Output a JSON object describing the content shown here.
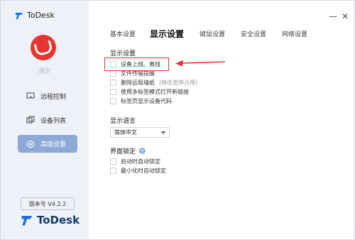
{
  "app": {
    "title": "ToDesk",
    "brand_bottom": "ToDesk"
  },
  "window_controls": {
    "minimize": "—",
    "close": "✕"
  },
  "user": {
    "name": "满岁"
  },
  "sidebar": {
    "items": [
      {
        "label": "远程控制",
        "icon": "remote-control-icon"
      },
      {
        "label": "设备列表",
        "icon": "device-list-icon"
      },
      {
        "label": "高级设置",
        "icon": "settings-icon",
        "active": true
      }
    ],
    "version": "版本号 V4.2.2"
  },
  "tabs": [
    {
      "label": "基本设置"
    },
    {
      "label": "显示设置",
      "active": true
    },
    {
      "label": "键鼠设置"
    },
    {
      "label": "安全设置"
    },
    {
      "label": "网络设置"
    }
  ],
  "display_settings": {
    "title": "显示设置",
    "options": [
      {
        "label": "设备上线、离线",
        "checked": false
      },
      {
        "label": "文件传输提醒",
        "checked": false
      },
      {
        "label": "删除远程墙纸",
        "hint": "(降低宽带占用)",
        "checked": false
      },
      {
        "label": "使用多标签模式打开新链接",
        "checked": false
      },
      {
        "label": "标签页显示设备代码",
        "checked": false
      }
    ]
  },
  "language": {
    "title": "显示语言",
    "selected": "简体中文"
  },
  "lock": {
    "title": "界面锁定",
    "options": [
      {
        "label": "启动时自动锁定",
        "checked": false
      },
      {
        "label": "最小化时自动锁定",
        "checked": false
      }
    ]
  },
  "colors": {
    "accent": "#8da9d6",
    "annotation": "#e33333",
    "avatar": "#e8342f"
  }
}
